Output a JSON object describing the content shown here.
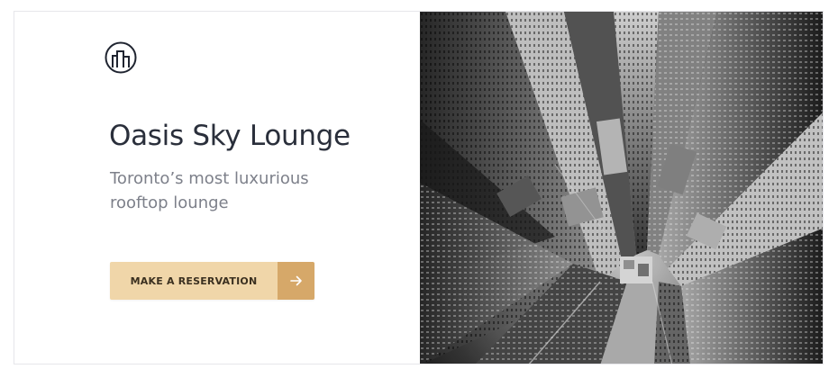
{
  "brand": {
    "logo_icon": "city-buildings-icon"
  },
  "hero": {
    "title": "Oasis Sky Lounge",
    "subtitle": "Toronto’s most luxurious rooftop lounge",
    "cta_label": "MAKE A RESERVATION",
    "cta_icon": "arrow-right-icon"
  },
  "photo": {
    "subject": "aerial-skyscrapers-image",
    "style": "grayscale"
  },
  "colors": {
    "title": "#2a2f3b",
    "subtitle": "#7d808a",
    "cta_light": "#f0d6a9",
    "cta_dark": "#d6a869"
  }
}
